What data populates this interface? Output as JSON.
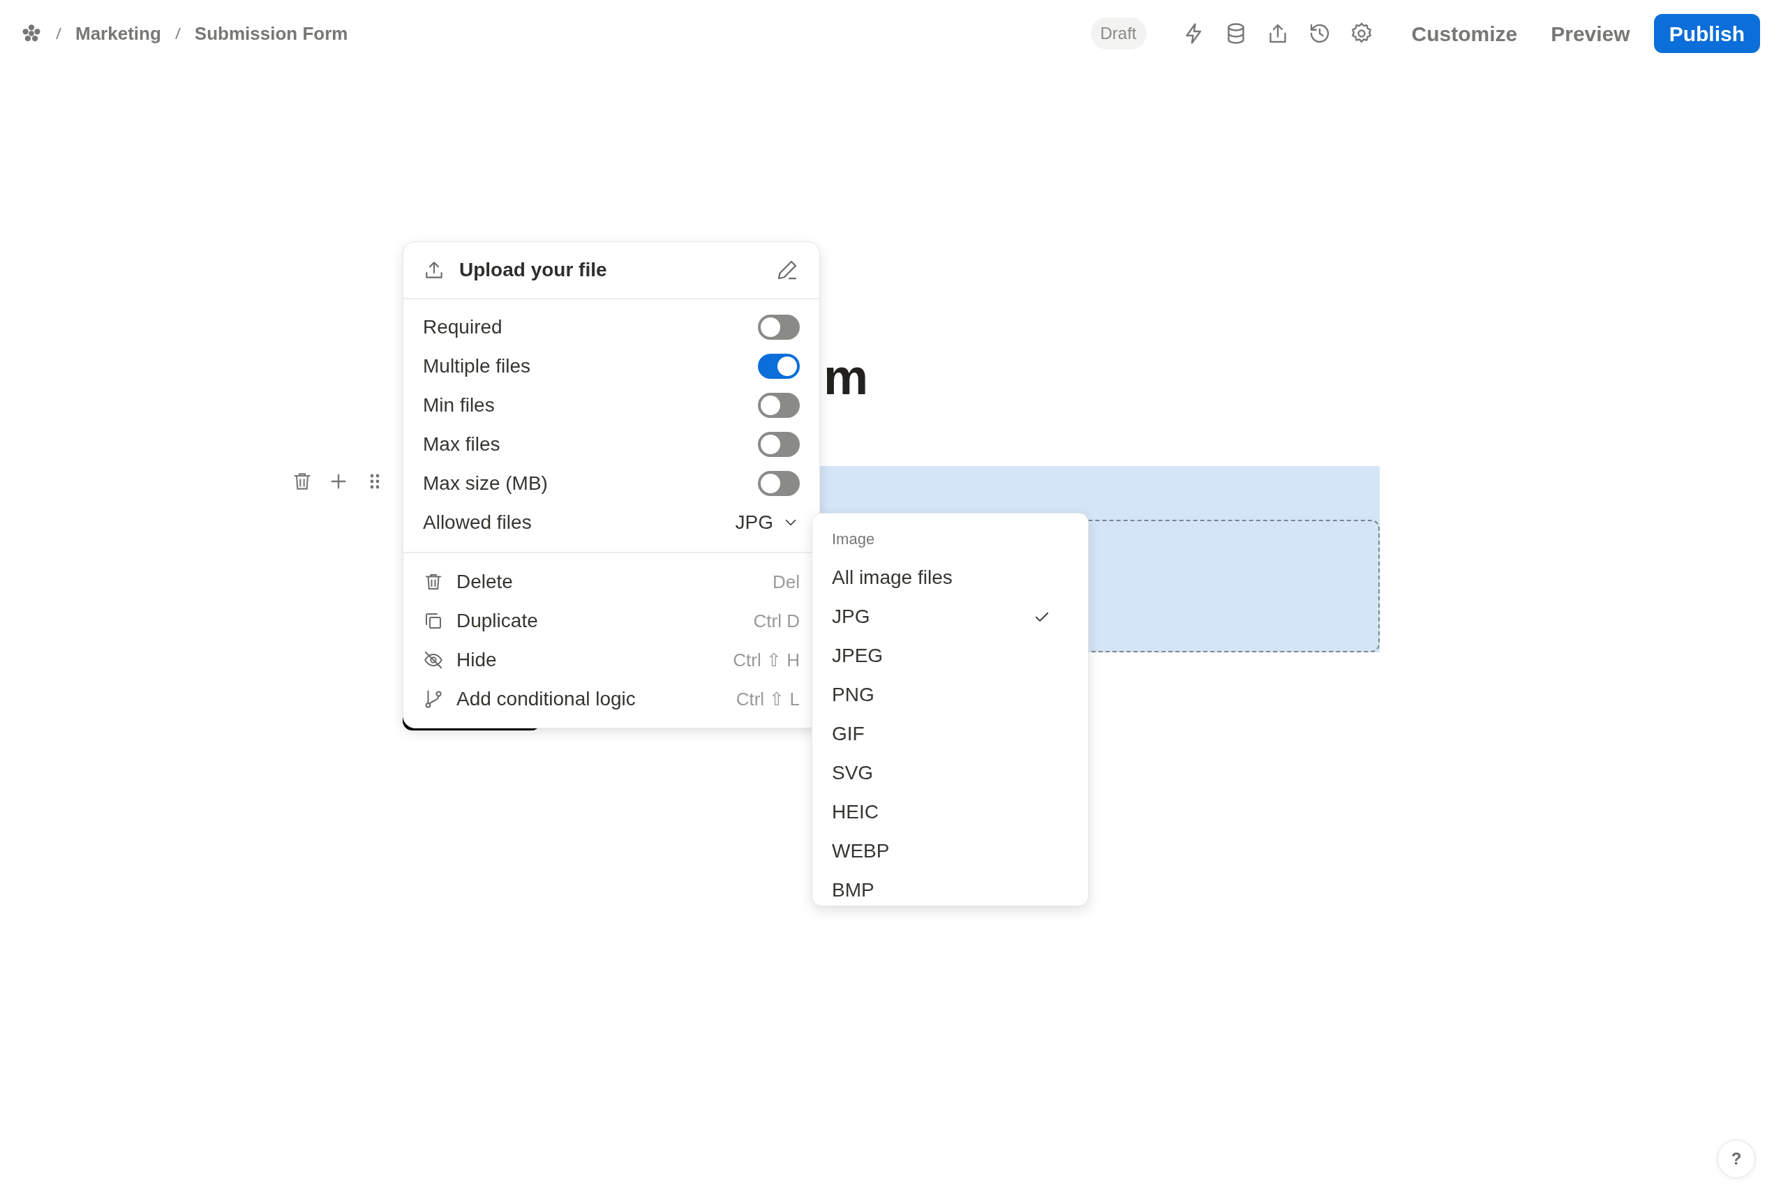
{
  "breadcrumb": [
    {
      "label": "Marketing"
    },
    {
      "label": "Submission Form"
    }
  ],
  "status_badge": "Draft",
  "actions": [
    {
      "label": "Customize",
      "kind": "text"
    },
    {
      "label": "Preview",
      "kind": "text"
    },
    {
      "label": "Publish",
      "kind": "primary"
    }
  ],
  "form": {
    "title_fragment": "m"
  },
  "field_menu": {
    "title": "Upload your file",
    "settings": [
      {
        "label": "Required",
        "kind": "toggle",
        "on": false
      },
      {
        "label": "Multiple files",
        "kind": "toggle",
        "on": true
      },
      {
        "label": "Min files",
        "kind": "toggle",
        "on": false
      },
      {
        "label": "Max files",
        "kind": "toggle",
        "on": false
      },
      {
        "label": "Max size (MB)",
        "kind": "toggle",
        "on": false
      },
      {
        "label": "Allowed files",
        "kind": "select",
        "value": "JPG"
      }
    ],
    "actions": [
      {
        "label": "Delete",
        "shortcut": "Del"
      },
      {
        "label": "Duplicate",
        "shortcut": "Ctrl D"
      },
      {
        "label": "Hide",
        "shortcut": "Ctrl ⇧ H"
      },
      {
        "label": "Add conditional logic",
        "shortcut": "Ctrl ⇧ L"
      }
    ]
  },
  "file_type_dropdown": {
    "group": "Image",
    "options": [
      {
        "label": "All image files",
        "selected": false
      },
      {
        "label": "JPG",
        "selected": true
      },
      {
        "label": "JPEG",
        "selected": false
      },
      {
        "label": "PNG",
        "selected": false
      },
      {
        "label": "GIF",
        "selected": false
      },
      {
        "label": "SVG",
        "selected": false
      },
      {
        "label": "HEIC",
        "selected": false
      },
      {
        "label": "WEBP",
        "selected": false
      },
      {
        "label": "BMP",
        "selected": false
      }
    ]
  },
  "help_button": "?"
}
